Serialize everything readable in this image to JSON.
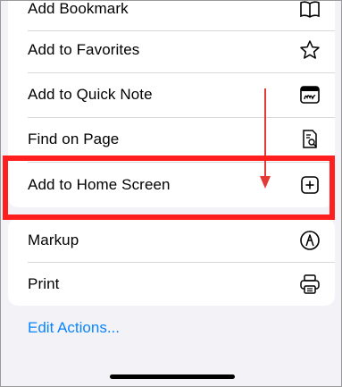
{
  "menu": {
    "items": [
      {
        "label": "Add Bookmark",
        "icon": "book-icon"
      },
      {
        "label": "Add to Favorites",
        "icon": "star-icon"
      },
      {
        "label": "Add to Quick Note",
        "icon": "quick-note-icon"
      },
      {
        "label": "Find on Page",
        "icon": "find-on-page-icon"
      },
      {
        "label": "Add to Home Screen",
        "icon": "plus-square-icon"
      },
      {
        "label": "Markup",
        "icon": "markup-icon"
      },
      {
        "label": "Print",
        "icon": "printer-icon"
      }
    ],
    "edit_actions_label": "Edit Actions..."
  },
  "colors": {
    "highlight": "#ff1f1f",
    "link": "#0a84ff"
  }
}
